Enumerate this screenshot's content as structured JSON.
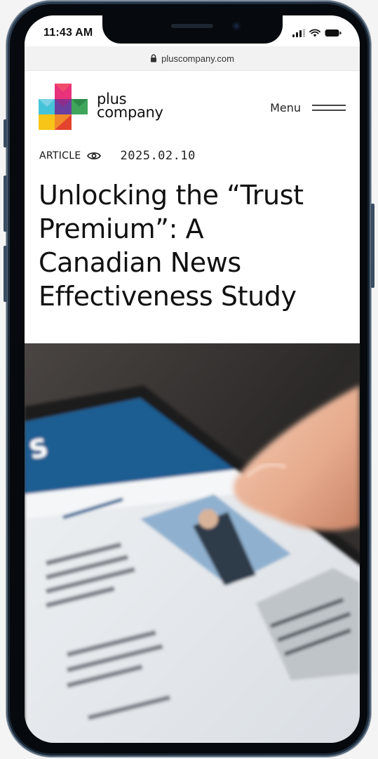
{
  "status_bar": {
    "time": "11:43 AM"
  },
  "browser": {
    "url": "pluscompany.com",
    "lock_icon": "lock-icon"
  },
  "site": {
    "logo": {
      "line1": "plus",
      "line2": "company"
    },
    "menu_label": "Menu"
  },
  "article": {
    "type_label": "ARTICLE",
    "view_icon": "eye-icon",
    "date": "2025.02.10",
    "headline_lines": [
      "Unlocking the “Trust",
      "Premium”: A",
      "Canadian News",
      "Effectiveness Study"
    ]
  },
  "hero_image": {
    "subject": "hand-touching-news-app-on-phone"
  },
  "colors": {
    "logo_pink": "#e8327a",
    "logo_purple": "#6b3fa0",
    "logo_cyan": "#45c4d9",
    "logo_yellow": "#f7c518",
    "logo_green": "#3fa55b",
    "logo_red": "#e4432d",
    "news_app_blue": "#1d5d92"
  }
}
